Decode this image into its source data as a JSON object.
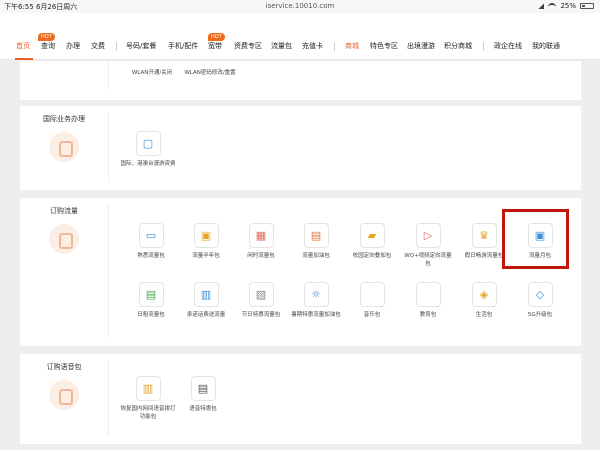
{
  "status_bar": {
    "time": "下午6:55 6月26日周六",
    "url": "iservice.10010.com",
    "battery": "25%"
  },
  "nav": {
    "items": [
      {
        "label": "首页"
      },
      {
        "label": "查询"
      },
      {
        "label": "办理"
      },
      {
        "label": "交费"
      },
      {
        "label": "号码/套餐"
      },
      {
        "label": "手机/配件"
      },
      {
        "label": "宽带"
      },
      {
        "label": "资费专区"
      },
      {
        "label": "流量包"
      },
      {
        "label": "充值卡"
      },
      {
        "label": "商城"
      },
      {
        "label": "特色专区"
      },
      {
        "label": "出境漫游"
      },
      {
        "label": "积分商城"
      },
      {
        "label": "政企在线"
      },
      {
        "label": "我的联通"
      }
    ],
    "hot_badge": "HOT"
  },
  "sections": {
    "wlan": {
      "items": [
        {
          "label": "WLAN开通/关闭"
        },
        {
          "label": "WLAN密码修改/重置"
        }
      ]
    },
    "intl": {
      "title": "国际业务办理",
      "items": [
        {
          "label": "国际、港澳台漫游资费"
        }
      ]
    },
    "traffic": {
      "title": "订购流量",
      "items": [
        {
          "label": "熟悉流量包",
          "icon": "▭",
          "color": "#3a8fd9"
        },
        {
          "label": "流量半年包",
          "icon": "▣",
          "color": "#e8a324"
        },
        {
          "label": "闲时流量包",
          "icon": "▦",
          "color": "#e36a58"
        },
        {
          "label": "流量加油包",
          "icon": "▤",
          "color": "#e8763a"
        },
        {
          "label": "校园定向叠加包",
          "icon": "▰",
          "color": "#e8a324"
        },
        {
          "label": "WO+视频定向流量包",
          "icon": "▷",
          "color": "#e36a58"
        },
        {
          "label": "假日畅游流量包",
          "icon": "♛",
          "color": "#e8a324"
        },
        {
          "label": "流量月包",
          "icon": "▣",
          "color": "#3a8fd9"
        },
        {
          "label": "日租流量包",
          "icon": "▤",
          "color": "#4aa84a"
        },
        {
          "label": "承诺话费送流量",
          "icon": "▥",
          "color": "#3a8fd9"
        },
        {
          "label": "节日特惠流量包",
          "icon": "▧",
          "color": "#888888"
        },
        {
          "label": "暑期特惠流量加油包",
          "icon": "☼",
          "color": "#3a8fd9"
        },
        {
          "label": "音乐包",
          "icon": "",
          "color": "#cccccc"
        },
        {
          "label": "教育包",
          "icon": "",
          "color": "#cccccc"
        },
        {
          "label": "生活包",
          "icon": "◈",
          "color": "#e8a324"
        },
        {
          "label": "5G升级包",
          "icon": "◇",
          "color": "#3a8fd9"
        }
      ]
    },
    "voice": {
      "title": "订购语音包",
      "items": [
        {
          "label": "恢复国内网间语音拨打功能包"
        },
        {
          "label": "语音特惠包"
        }
      ]
    }
  }
}
